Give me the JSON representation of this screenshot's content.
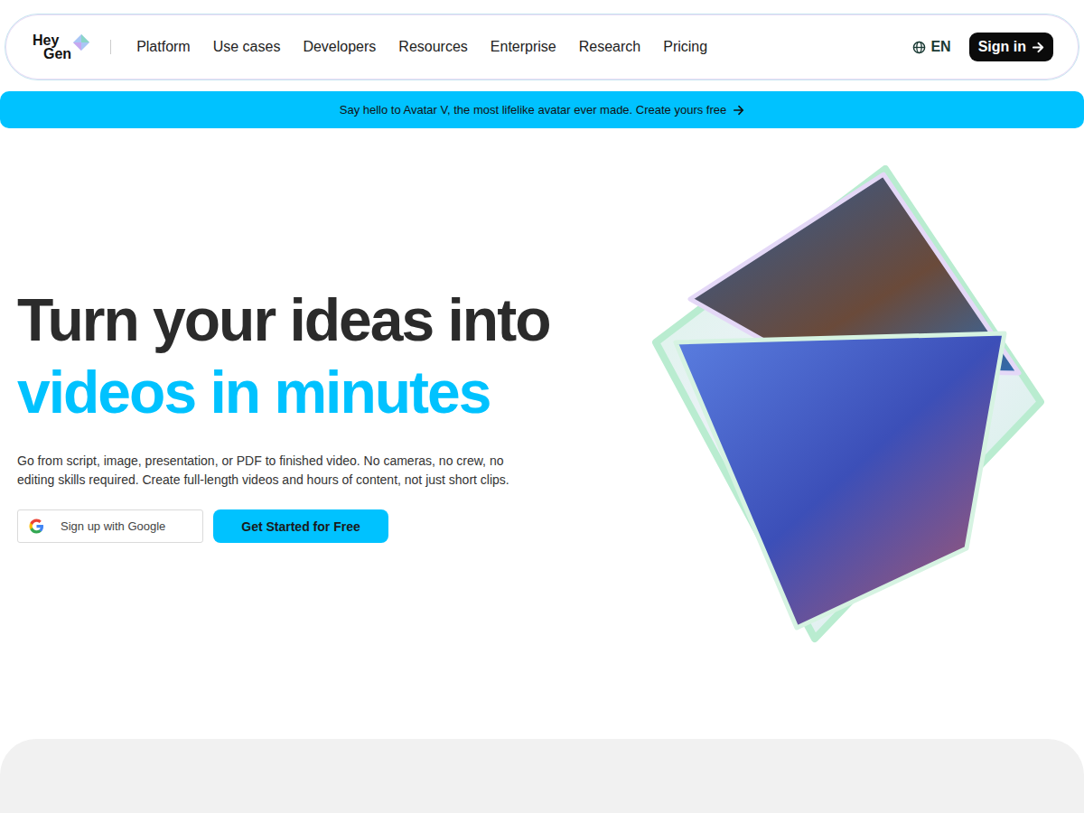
{
  "logo": {
    "line1": "Hey",
    "line2": "Gen"
  },
  "nav": {
    "items": [
      "Platform",
      "Use cases",
      "Developers",
      "Resources",
      "Enterprise",
      "Research",
      "Pricing"
    ],
    "language": "EN",
    "sign_in": "Sign in"
  },
  "banner": {
    "text": "Say hello to Avatar V, the most lifelike avatar ever made. Create yours free"
  },
  "hero": {
    "title_line1": "Turn your ideas into",
    "title_line2": "videos in minutes",
    "description": "Go from script, image, presentation, or PDF to finished video. No cameras, no crew, no editing skills required. Create full-length videos and hours of content, not just short clips.",
    "google_button": "Sign up with Google",
    "cta": "Get Started for Free"
  }
}
